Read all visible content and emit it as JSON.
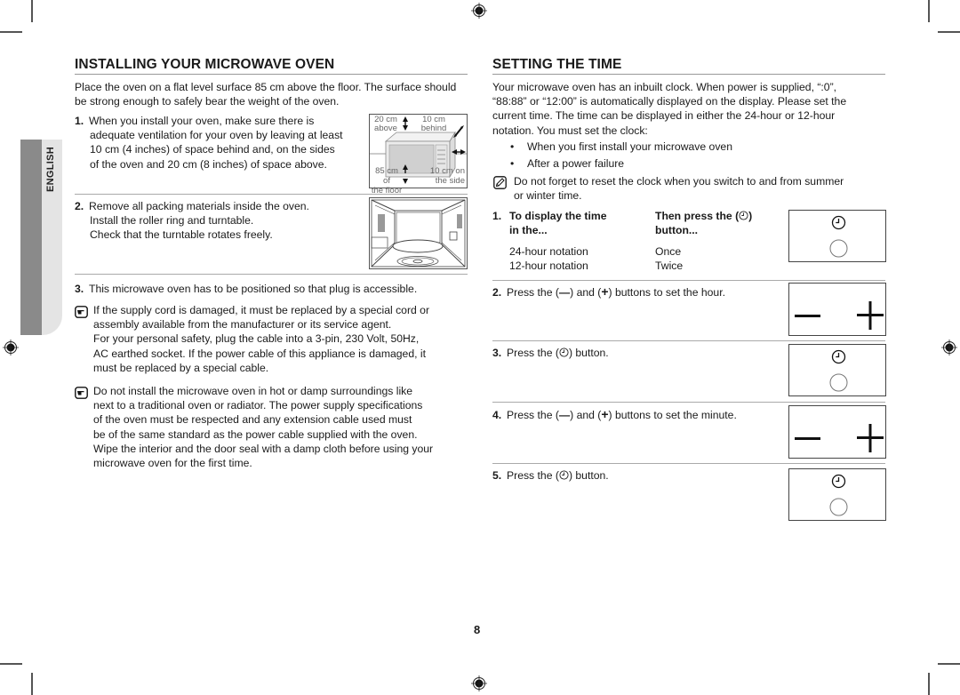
{
  "page": {
    "number": "8",
    "language_tab": "ENGLISH"
  },
  "installing": {
    "title": "INSTALLING YOUR MICROWAVE OVEN",
    "intro": "Place the oven on a flat level surface 85 cm above the floor. The surface should be strong enough to safely bear the weight of the oven.",
    "steps": [
      {
        "number": "1.",
        "lines": [
          "When you install your oven, make sure there is",
          "adequate ventilation for your oven by leaving at least",
          "10 cm (4 inches) of space behind and, on the sides",
          "of the oven and 20 cm (8 inches) of space above."
        ],
        "figure_labels": {
          "above": [
            "20 cm",
            "above"
          ],
          "behind": [
            "10 cm",
            "behind"
          ],
          "floor": [
            "85 cm of",
            "the floor"
          ],
          "side": [
            "10 cm on",
            "the side"
          ]
        }
      },
      {
        "number": "2.",
        "lines": [
          "Remove all packing materials inside the oven.",
          "Install the roller ring and turntable.",
          "Check that the turntable rotates freely."
        ]
      },
      {
        "number": "3.",
        "lines": [
          "This microwave oven has to be positioned so that plug is accessible."
        ]
      }
    ],
    "notes": [
      {
        "icon": "pointing-hand-icon",
        "lines": [
          "If the supply cord is damaged, it must be replaced by a special cord or",
          "assembly available from the manufacturer or its service agent.",
          "For your personal safety, plug the cable into a 3-pin, 230 Volt, 50Hz,",
          "AC earthed socket. If the power cable of this appliance is damaged, it",
          "must be replaced by a special cable."
        ]
      },
      {
        "icon": "pointing-hand-icon",
        "lines": [
          "Do not install the microwave oven in hot or damp surroundings like",
          "next to a traditional oven or radiator. The power supply specifications",
          "of the oven must be respected and any extension cable used must",
          "be of the same standard as the power cable supplied with the oven.",
          "Wipe the interior and the door seal with a damp cloth before using your",
          "microwave oven for the first time."
        ]
      }
    ]
  },
  "setting_time": {
    "title": "SETTING THE TIME",
    "intro_lines": [
      "Your microwave oven has an inbuilt clock. When power is supplied, “:0”,",
      "“88:88” or “12:00” is automatically displayed on the display. Please set the",
      "current time. The time can be displayed in either the 24-hour or 12-hour",
      "notation. You must set the clock:"
    ],
    "bullets": [
      "When you first install your microwave oven",
      "After a power failure"
    ],
    "note": {
      "icon": "note-pencil-icon",
      "lines": [
        "Do not forget to reset the clock when you switch to and from summer",
        "or winter time."
      ]
    },
    "step1": {
      "number": "1.",
      "col1_header": [
        "To display the time",
        "in the..."
      ],
      "col2_header_a": "Then press the (",
      "col2_header_b": ")",
      "col2_header_line2": "button...",
      "rows": [
        {
          "notation": "24-hour notation",
          "press": "Once"
        },
        {
          "notation": "12-hour notation",
          "press": "Twice"
        }
      ]
    },
    "step2": {
      "number": "2.",
      "a": "Press the (",
      "b": ") and (",
      "c": ") buttons to set the hour."
    },
    "step3": {
      "number": "3.",
      "a": "Press the (",
      "b": ") button."
    },
    "step4": {
      "number": "4.",
      "a": "Press the (",
      "b": ") and (",
      "c": ") buttons to set the minute."
    },
    "step5": {
      "number": "5.",
      "a": "Press the (",
      "b": ") button."
    }
  }
}
